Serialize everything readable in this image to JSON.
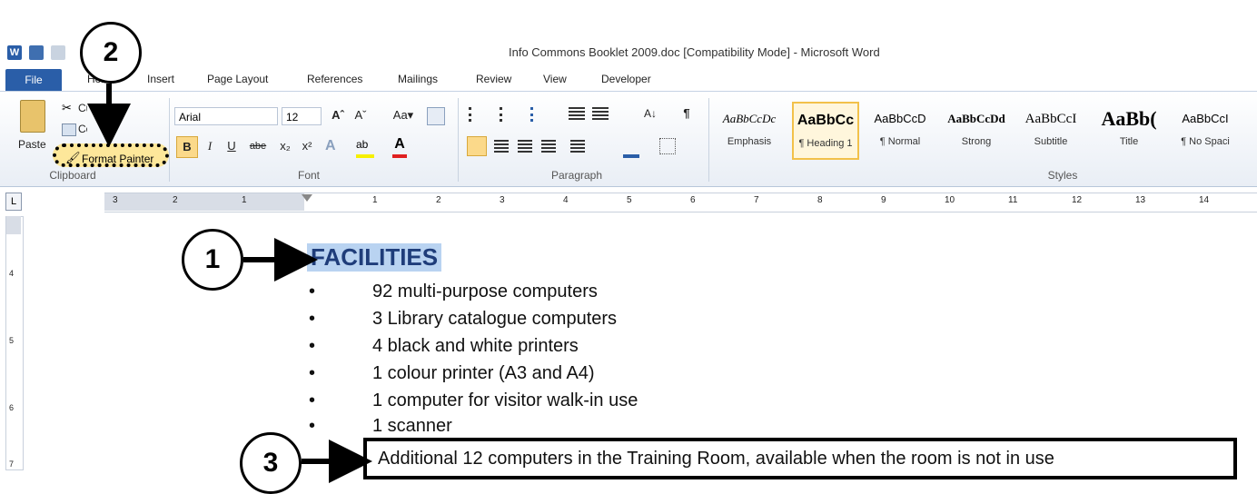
{
  "window": {
    "title": "Info Commons Booklet 2009.doc [Compatibility Mode]  -  Microsoft Word",
    "app_icon_letter": "W"
  },
  "tabs": [
    "File",
    "Home",
    "Insert",
    "Page Layout",
    "References",
    "Mailings",
    "Review",
    "View",
    "Developer"
  ],
  "ribbon": {
    "clipboard": {
      "paste": "Paste",
      "cut": "Cut",
      "copy": "Copy",
      "format_painter": "Format Painter",
      "group_label": "Clipboard"
    },
    "font": {
      "font_name": "Arial",
      "font_size": "12",
      "grow": "Aˆ",
      "shrink": "Aˇ",
      "change_case": "Aa▾",
      "bold": "B",
      "italic": "I",
      "underline": "U",
      "strike": "abe",
      "subscript": "x₂",
      "superscript": "x²",
      "group_label": "Font"
    },
    "paragraph": {
      "show_hide": "¶",
      "sort": "A↓",
      "group_label": "Paragraph"
    },
    "styles": {
      "group_label": "Styles",
      "items": [
        {
          "sample": "AaBbCcDc",
          "name": "Emphasis"
        },
        {
          "sample": "AaBbCc",
          "name": "¶ Heading 1"
        },
        {
          "sample": "AaBbCcD",
          "name": "¶ Normal"
        },
        {
          "sample": "AaBbCcDd",
          "name": "Strong"
        },
        {
          "sample": "AaBbCcI",
          "name": "Subtitle"
        },
        {
          "sample": "AaBb(",
          "name": "Title"
        },
        {
          "sample": "AaBbCcI",
          "name": "¶ No Spaci"
        }
      ]
    }
  },
  "ruler": {
    "corner": "L",
    "left_marks": [
      "3",
      "2",
      "1"
    ],
    "marks": [
      "1",
      "2",
      "3",
      "4",
      "5",
      "6",
      "7",
      "8",
      "9",
      "10",
      "11",
      "12",
      "13",
      "14"
    ]
  },
  "vruler": {
    "marks": [
      "4",
      "5",
      "6",
      "7"
    ]
  },
  "document": {
    "heading": "FACILITIES",
    "bullets": [
      "92 multi-purpose computers",
      "3 Library catalogue computers",
      "4 black and white printers",
      "1 colour printer (A3 and A4)",
      "1 computer for visitor walk-in use",
      "1 scanner"
    ],
    "bullet_char": "•",
    "highlighted_line": "Additional 12 computers in the Training Room, available when the room is not in use"
  },
  "annotations": {
    "one": "1",
    "two": "2",
    "three": "3"
  },
  "colors": {
    "file_tab": "#2a5ea8",
    "heading_text": "#1f3d7a",
    "heading_highlight": "#b9d3f1",
    "format_painter_highlight": "#fde79a"
  }
}
